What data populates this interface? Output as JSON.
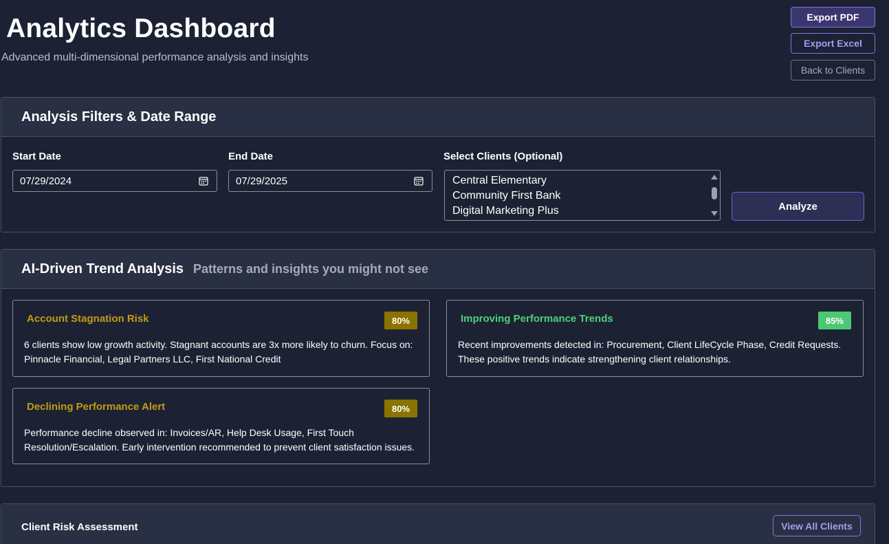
{
  "header": {
    "title": "Analytics Dashboard",
    "subtitle": "Advanced multi-dimensional performance analysis and insights"
  },
  "actions": {
    "export_pdf": "Export PDF",
    "export_excel": "Export Excel",
    "back": "Back to Clients"
  },
  "filters": {
    "title": "Analysis Filters & Date Range",
    "start_label": "Start Date",
    "start_value": "07/29/2024",
    "end_label": "End Date",
    "end_value": "07/29/2025",
    "clients_label": "Select Clients (Optional)",
    "clients": [
      "Central Elementary",
      "Community First Bank",
      "Digital Marketing Plus"
    ],
    "analyze": "Analyze"
  },
  "trends": {
    "title": "AI-Driven Trend Analysis",
    "subtitle": "Patterns and insights you might not see",
    "cards": [
      {
        "title": "Account Stagnation Risk",
        "badge": "80%",
        "text": "6 clients show low growth activity. Stagnant accounts are 3x more likely to churn. Focus on: Pinnacle Financial, Legal Partners LLC, First National Credit",
        "title_color": "#c49a12",
        "badge_color": "#8a7300"
      },
      {
        "title": "Improving Performance Trends",
        "badge": "85%",
        "text": "Recent improvements detected in: Procurement, Client LifeCycle Phase, Credit Requests. These positive trends indicate strengthening client relationships.",
        "title_color": "#4fd07a",
        "badge_color": "#4cc873"
      },
      {
        "title": "Declining Performance Alert",
        "badge": "80%",
        "text": "Performance decline observed in: Invoices/AR, Help Desk Usage, First Touch Resolution/Escalation. Early intervention recommended to prevent client satisfaction issues.",
        "title_color": "#c49a12",
        "badge_color": "#8a7300"
      }
    ]
  },
  "risk": {
    "title": "Client Risk Assessment",
    "view_all": "View All Clients"
  },
  "colors": {
    "background": "#1c2233",
    "panel_header": "#2a3043",
    "accent": "#7f77e0",
    "warning": "#c49a12",
    "success": "#4fd07a"
  },
  "icons": {
    "date_picker": "calendar-icon"
  }
}
